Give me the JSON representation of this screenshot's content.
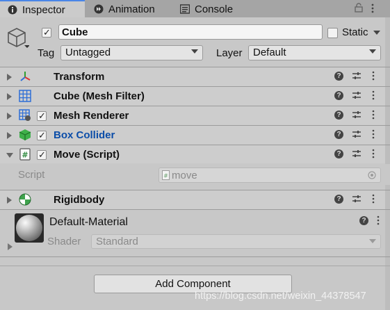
{
  "tabs": [
    {
      "label": "Inspector",
      "icon": "info-icon",
      "active": true
    },
    {
      "label": "Animation",
      "icon": "animation-icon",
      "active": false
    },
    {
      "label": "Console",
      "icon": "console-icon",
      "active": false
    }
  ],
  "object": {
    "name": "Cube",
    "active": true,
    "static_label": "Static",
    "tag_label": "Tag",
    "tag_value": "Untagged",
    "layer_label": "Layer",
    "layer_value": "Default"
  },
  "components": [
    {
      "title": "Transform",
      "icon": "transform-icon",
      "has_toggle": false,
      "expanded": false
    },
    {
      "title": "Cube (Mesh Filter)",
      "icon": "mesh-filter-icon",
      "has_toggle": false,
      "expanded": false
    },
    {
      "title": "Mesh Renderer",
      "icon": "mesh-renderer-icon",
      "has_toggle": true,
      "expanded": false
    },
    {
      "title": "Box Collider",
      "icon": "box-collider-icon",
      "has_toggle": true,
      "expanded": false
    },
    {
      "title": "Move (Script)",
      "icon": "script-icon",
      "has_toggle": true,
      "expanded": true
    },
    {
      "title": "Rigidbody",
      "icon": "rigidbody-icon",
      "has_toggle": false,
      "expanded": false
    }
  ],
  "script_field": {
    "label": "Script",
    "value": "move"
  },
  "material": {
    "name": "Default-Material",
    "shader_label": "Shader",
    "shader_value": "Standard"
  },
  "add_component_label": "Add Component",
  "watermark": "https://blog.csdn.net/weixin_44378547",
  "colors": {
    "accent_tab": "#4a86e8",
    "box_collider_title": "#0b4da8",
    "panel_bg": "#c8c8c8"
  }
}
